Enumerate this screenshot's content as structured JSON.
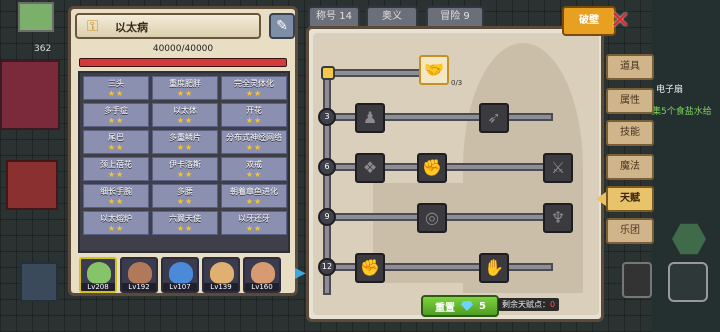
{
  "hud": {
    "coins": "362"
  },
  "background": {
    "location_label": "电子扇",
    "quest_text": "集5个食盐水给"
  },
  "character": {
    "key_icon": "key-icon",
    "name": "以太病",
    "hp_text": "40000/40000",
    "hp_fraction": 1.0,
    "tool_icon": "syringe-icon"
  },
  "talents": [
    {
      "name": "三头",
      "stars": "★★"
    },
    {
      "name": "重度肥胖",
      "stars": "★★"
    },
    {
      "name": "完全灵体化",
      "stars": "★★"
    },
    {
      "name": "多手症",
      "stars": "★★"
    },
    {
      "name": "以太体",
      "stars": "★★"
    },
    {
      "name": "开花",
      "stars": "★★"
    },
    {
      "name": "尾巴",
      "stars": "★★"
    },
    {
      "name": "多重鳞片",
      "stars": "★★"
    },
    {
      "name": "分布式神经网络",
      "stars": "★★"
    },
    {
      "name": "颈上蓓花",
      "stars": "★★"
    },
    {
      "name": "伊卡洛斯",
      "stars": "★★"
    },
    {
      "name": "双戒",
      "stars": "★★"
    },
    {
      "name": "细长手腕",
      "stars": "★★"
    },
    {
      "name": "多腰",
      "stars": "★★"
    },
    {
      "name": "朝着章鱼进化",
      "stars": "★★"
    },
    {
      "name": "以太熔炉",
      "stars": "★★"
    },
    {
      "name": "六翼天使",
      "stars": "★★"
    },
    {
      "name": "以牙还牙",
      "stars": "★★"
    }
  ],
  "heroes": [
    {
      "level": "Lv208",
      "color": "#86c46a",
      "active": true
    },
    {
      "level": "Lv192",
      "color": "#b07a5a",
      "active": false
    },
    {
      "level": "Lv107",
      "color": "#4a8ad8",
      "active": false
    },
    {
      "level": "Lv139",
      "color": "#e0b070",
      "active": false
    },
    {
      "level": "Lv160",
      "color": "#d89a70",
      "active": false
    }
  ],
  "top_tabs": [
    "称号 14",
    "奥义",
    "冒险 9"
  ],
  "breakthrough_label": "破壁",
  "side_tabs": [
    {
      "label": "道具",
      "active": false
    },
    {
      "label": "属性",
      "active": false
    },
    {
      "label": "技能",
      "active": false
    },
    {
      "label": "魔法",
      "active": false
    },
    {
      "label": "天赋",
      "active": true
    },
    {
      "label": "乐团",
      "active": false
    }
  ],
  "tree": {
    "node_count": "0/3",
    "tiers": [
      "3",
      "6",
      "9",
      "12"
    ],
    "nodes": [
      {
        "icon": "handshake-icon",
        "active": true
      },
      {
        "icon": "body-icon",
        "active": false
      },
      {
        "icon": "arrow-icon",
        "active": false
      },
      {
        "icon": "scroll-icon",
        "active": false
      },
      {
        "icon": "fist-strike-icon",
        "active": false
      },
      {
        "icon": "blade-icon",
        "active": false
      },
      {
        "icon": "ripple-icon",
        "active": false
      },
      {
        "icon": "bat-icon",
        "active": false
      },
      {
        "icon": "fist-icon",
        "active": false
      },
      {
        "icon": "claw-icon",
        "active": false
      }
    ]
  },
  "reset": {
    "label": "重置",
    "cost": "5"
  },
  "remaining": {
    "label": "剩余天赋点：",
    "value": "0"
  },
  "colors": {
    "hp_bar": "#d33b3b",
    "accent_gold": "#e8c36a",
    "reset_green": "#4f9c22"
  }
}
